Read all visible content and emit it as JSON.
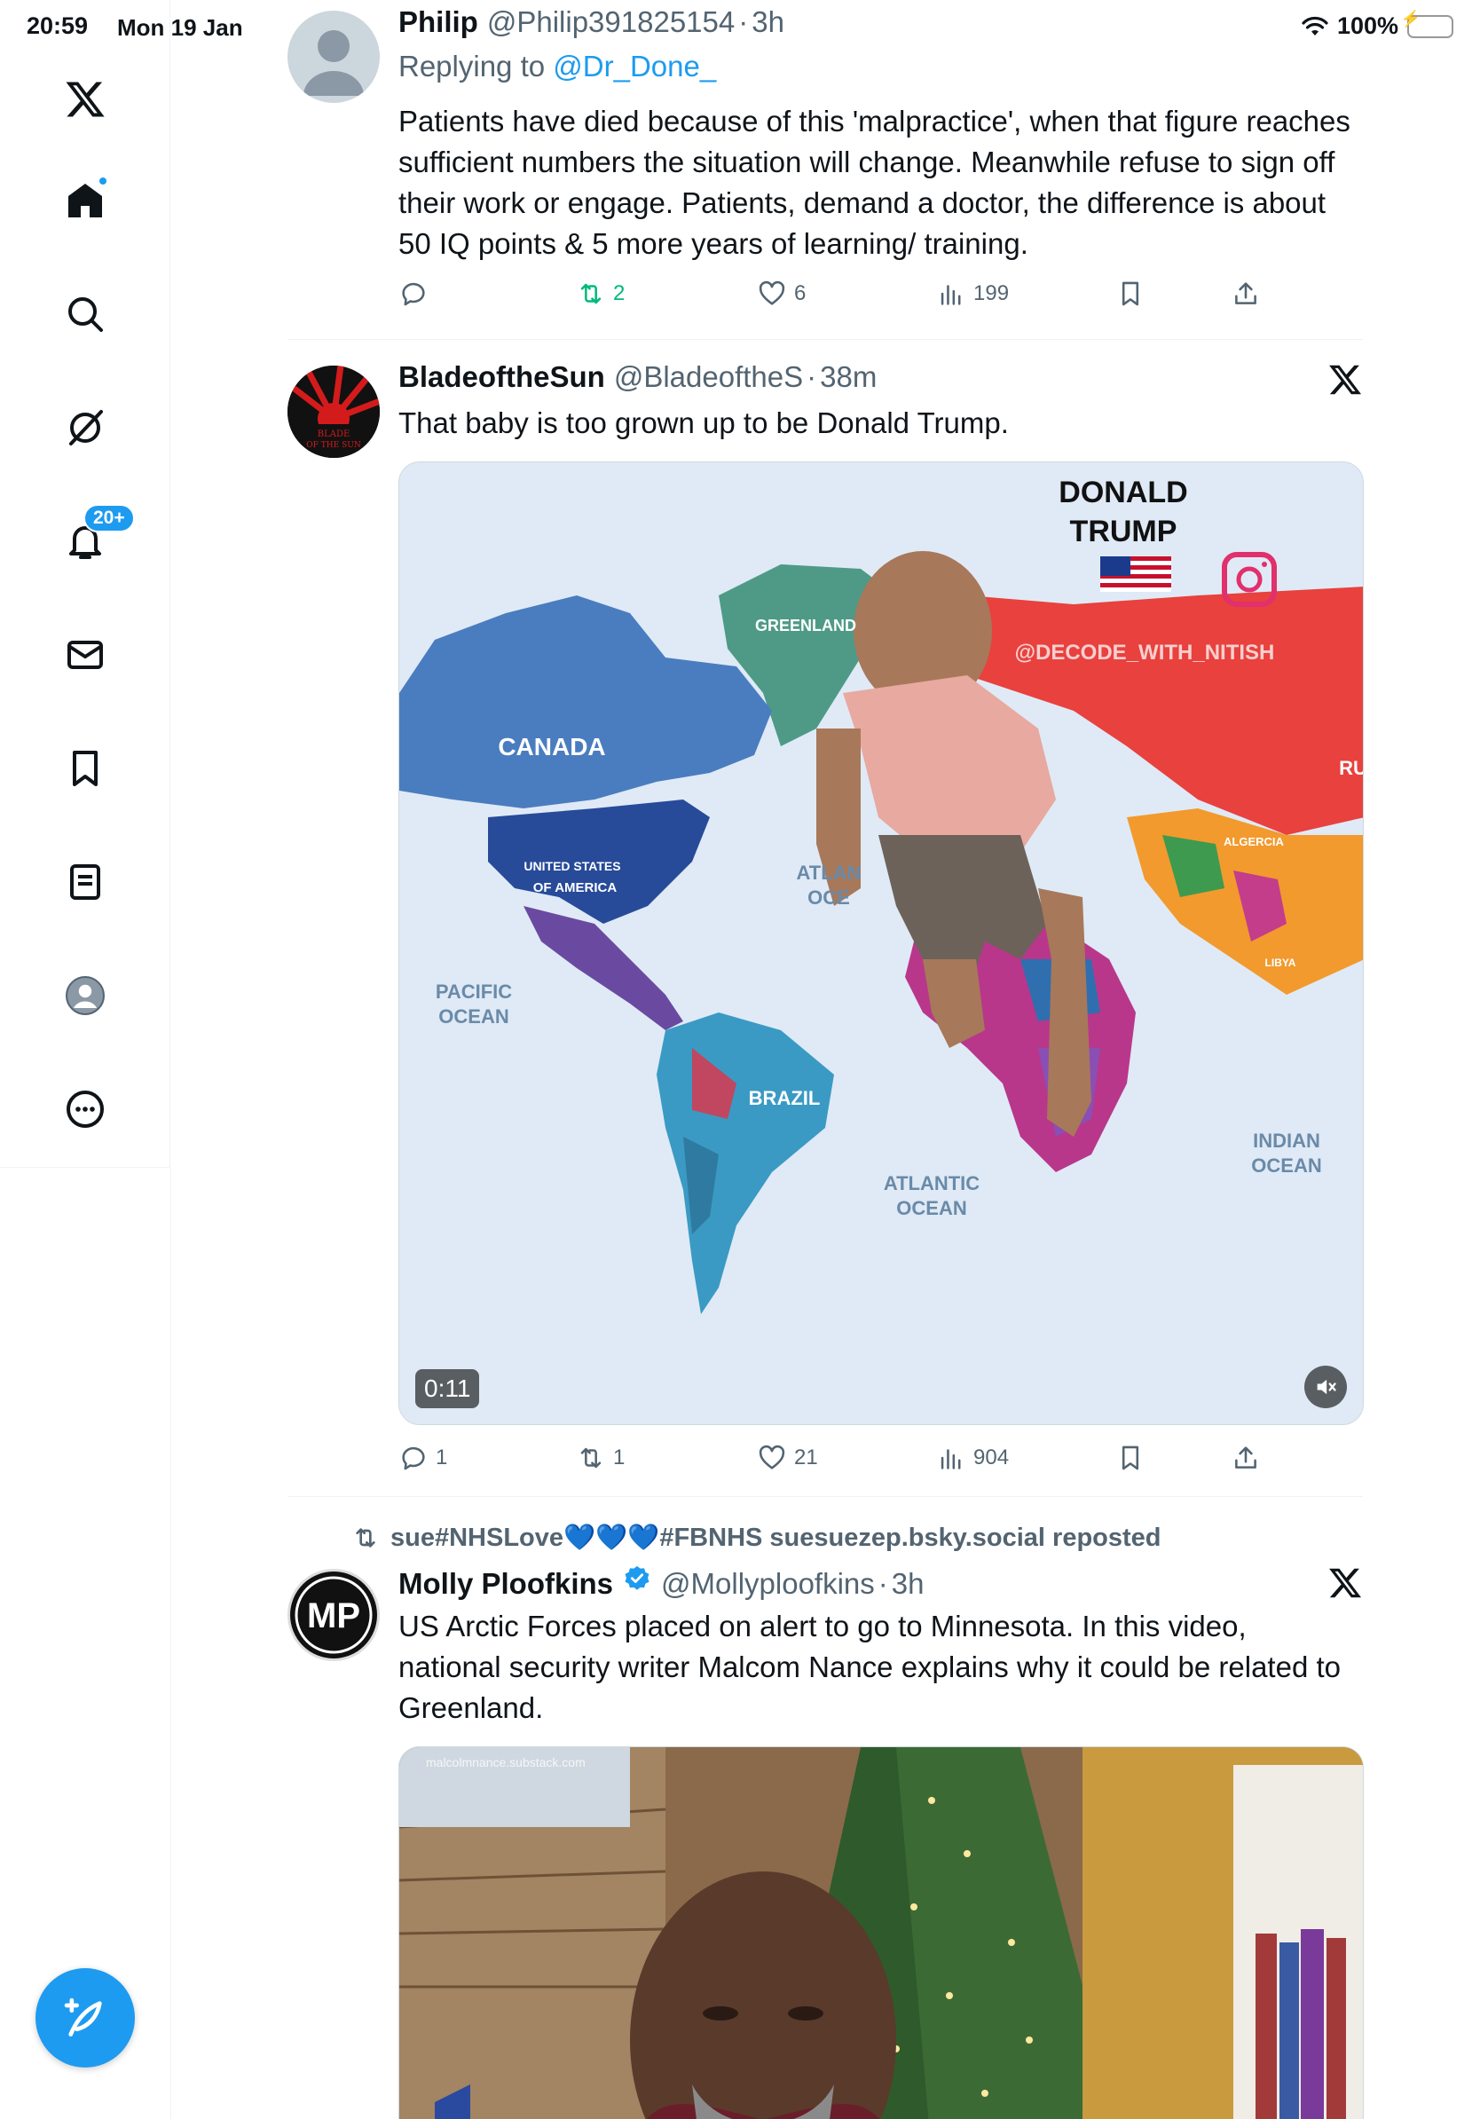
{
  "status_bar": {
    "time": "20:59",
    "date": "Mon 19 Jan",
    "battery": "100%"
  },
  "sidebar": {
    "notifications_badge": "20+",
    "items": [
      "x-logo",
      "home",
      "search",
      "grok",
      "notifications",
      "messages",
      "bookmarks",
      "lists",
      "profile",
      "more"
    ]
  },
  "tweets": [
    {
      "name": "Philip",
      "handle": "@Philip391825154",
      "time": "3h",
      "replying_label": "Replying to",
      "replying_to": "@Dr_Done_",
      "text": "Patients have died because of this 'malpractice', when that figure reaches sufficient numbers the situation will change. Meanwhile refuse to sign off their work or engage. Patients, demand a doctor, the difference is about 50 IQ points & 5 more years of learning/ training.",
      "replies": "",
      "retweets": "2",
      "likes": "6",
      "views": "199"
    },
    {
      "name": "BladeoftheSun",
      "handle": "@BladeoftheS",
      "time": "38m",
      "text": "That baby is too grown up to be Donald Trump.",
      "avatar_text": "BLADE OF THE SUN",
      "media": {
        "duration": "0:11",
        "overlay_title_1": "DONALD",
        "overlay_title_2": "TRUMP",
        "watermark": "@DECODE_WITH_NITISH",
        "labels": {
          "greenland": "GREENLAND",
          "canada": "CANADA",
          "usa_1": "UNITED STATES",
          "usa_2": "OF AMERICA",
          "pacific_1": "PACIFIC",
          "pacific_2": "OCEAN",
          "atlantic_n_1": "ATLAN",
          "atlantic_n_2": "OCE",
          "brazil": "BRAZIL",
          "atlantic_s_1": "ATLANTIC",
          "atlantic_s_2": "OCEAN",
          "indian_1": "INDIAN",
          "indian_2": "OCEAN",
          "algeria": "ALGERCIA",
          "libya": "LIBYA",
          "ru": "RU"
        }
      },
      "replies": "1",
      "retweets": "1",
      "likes": "21",
      "views": "904"
    },
    {
      "repost_line": "sue#NHSLove💙💙💙#FBNHS suesuezep.bsky.social reposted",
      "name": "Molly Ploofkins",
      "handle": "@Mollyploofkins",
      "time": "3h",
      "avatar_text": "MP",
      "text": "US Arctic Forces placed on alert to go to Minnesota. In this video, national security writer Malcom Nance explains why it could be related to Greenland.",
      "media_url_text": "malcolmnance.substack.com"
    }
  ],
  "separator": "·",
  "colors": {
    "accent": "#1d9bf0",
    "retweet": "#00ba7c",
    "muted": "#536471"
  }
}
